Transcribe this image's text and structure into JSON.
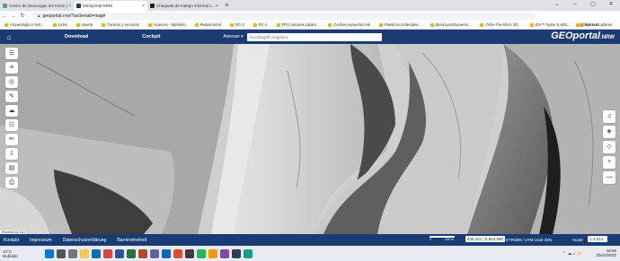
{
  "browser": {
    "tabs": [
      {
        "title": "Centro de Descargas del CNIG (",
        "active": false
      },
      {
        "title": "GEOportal.NRW",
        "active": true
      },
      {
        "title": "Chaqueta de trabajo informal c...",
        "active": false
      }
    ],
    "new_tab": "+",
    "url": "geoportal.nrw/?activetab=map#",
    "bookmarks": [
      "Arqueología e Hist...",
      "Links",
      "Huerta",
      "Turismo y recursos",
      "Avances - Wahlinfo",
      "Radiocontrol",
      "RC-2",
      "RC-1",
      "FPV,camaras,cables...",
      "Coches,repuestos elé",
      "Plasticos,materiales...",
      "Musica,instrumento...",
      "Order the Micro 3D...",
      "iOn™ Nylon & ABS...",
      "Nylon 6"
    ],
    "other_bookmarks": "Otros marcadores"
  },
  "geoportal": {
    "nav": [
      "Download",
      "Cockpit"
    ],
    "address_select": "Adresse ▾",
    "search_placeholder": "Suchbegriff eingeben...",
    "logo_main": "GEO",
    "logo_rest": "portal",
    "logo_suffix": ".NRW",
    "left_tools": [
      "☰",
      "≡",
      "◎",
      "✎",
      "☁",
      "☷",
      "✏",
      "⇩",
      "▤",
      "⎙"
    ],
    "right_tools": [
      "♫",
      "◈",
      "◇",
      "+",
      "—"
    ],
    "powered_by": "Powered by Esri"
  },
  "footer": {
    "links": [
      "Kontakt",
      "Impressum",
      "Datenschutzerklärung",
      "Barrierefreiheit"
    ],
    "scale_left": "0",
    "scale_right": "100 m",
    "coords": "436.421 | 5.663.580",
    "crs": "ETRS89 / UTM zone 32N",
    "scale_label": "Scale:",
    "scale_value": "1:4.514"
  },
  "taskbar": {
    "temp": "14°C",
    "condition": "Nublado",
    "time": "16:56",
    "date": "20/10/2022"
  }
}
